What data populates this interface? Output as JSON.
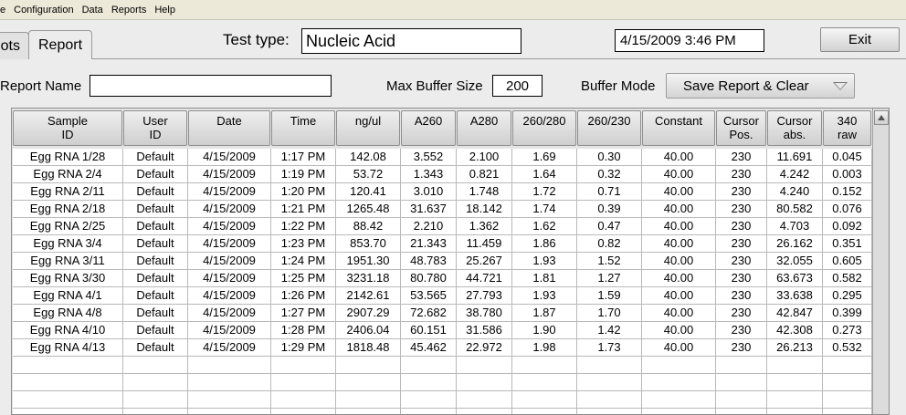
{
  "menubar": {
    "items": [
      "e",
      "Configuration",
      "Data",
      "Reports",
      "Help"
    ]
  },
  "tabs": [
    {
      "label": "ots",
      "selected": false
    },
    {
      "label": "Report",
      "selected": true
    }
  ],
  "header": {
    "test_type_label": "Test type:",
    "test_type_value": "Nucleic Acid",
    "datetime": "4/15/2009  3:46 PM",
    "exit_label": "Exit"
  },
  "controls": {
    "report_name_label": "Report Name",
    "report_name_value": "",
    "max_buffer_label": "Max Buffer Size",
    "max_buffer_value": "200",
    "buffer_mode_label": "Buffer Mode",
    "buffer_mode_value": "Save Report & Clear"
  },
  "table": {
    "columns": [
      "Sample\nID",
      "User\nID",
      "Date",
      "Time",
      "ng/ul",
      "A260",
      "A280",
      "260/280",
      "260/230",
      "Constant",
      "Cursor\nPos.",
      "Cursor\nabs.",
      "340\nraw"
    ],
    "rows": [
      [
        "Egg RNA 1/28",
        "Default",
        "4/15/2009",
        "1:17 PM",
        "142.08",
        "3.552",
        "2.100",
        "1.69",
        "0.30",
        "40.00",
        "230",
        "11.691",
        "0.045"
      ],
      [
        "Egg RNA 2/4",
        "Default",
        "4/15/2009",
        "1:19 PM",
        "53.72",
        "1.343",
        "0.821",
        "1.64",
        "0.32",
        "40.00",
        "230",
        "4.242",
        "0.003"
      ],
      [
        "Egg RNA 2/11",
        "Default",
        "4/15/2009",
        "1:20 PM",
        "120.41",
        "3.010",
        "1.748",
        "1.72",
        "0.71",
        "40.00",
        "230",
        "4.240",
        "0.152"
      ],
      [
        "Egg RNA 2/18",
        "Default",
        "4/15/2009",
        "1:21 PM",
        "1265.48",
        "31.637",
        "18.142",
        "1.74",
        "0.39",
        "40.00",
        "230",
        "80.582",
        "0.076"
      ],
      [
        "Egg RNA 2/25",
        "Default",
        "4/15/2009",
        "1:22 PM",
        "88.42",
        "2.210",
        "1.362",
        "1.62",
        "0.47",
        "40.00",
        "230",
        "4.703",
        "0.092"
      ],
      [
        "Egg RNA 3/4",
        "Default",
        "4/15/2009",
        "1:23 PM",
        "853.70",
        "21.343",
        "11.459",
        "1.86",
        "0.82",
        "40.00",
        "230",
        "26.162",
        "0.351"
      ],
      [
        "Egg RNA 3/11",
        "Default",
        "4/15/2009",
        "1:24 PM",
        "1951.30",
        "48.783",
        "25.267",
        "1.93",
        "1.52",
        "40.00",
        "230",
        "32.055",
        "0.605"
      ],
      [
        "Egg RNA 3/30",
        "Default",
        "4/15/2009",
        "1:25 PM",
        "3231.18",
        "80.780",
        "44.721",
        "1.81",
        "1.27",
        "40.00",
        "230",
        "63.673",
        "0.582"
      ],
      [
        "Egg RNA 4/1",
        "Default",
        "4/15/2009",
        "1:26 PM",
        "2142.61",
        "53.565",
        "27.793",
        "1.93",
        "1.59",
        "40.00",
        "230",
        "33.638",
        "0.295"
      ],
      [
        "Egg RNA 4/8",
        "Default",
        "4/15/2009",
        "1:27 PM",
        "2907.29",
        "72.682",
        "38.780",
        "1.87",
        "1.70",
        "40.00",
        "230",
        "42.847",
        "0.399"
      ],
      [
        "Egg RNA 4/10",
        "Default",
        "4/15/2009",
        "1:28 PM",
        "2406.04",
        "60.151",
        "31.586",
        "1.90",
        "1.42",
        "40.00",
        "230",
        "42.308",
        "0.273"
      ],
      [
        "Egg RNA 4/13",
        "Default",
        "4/15/2009",
        "1:29 PM",
        "1818.48",
        "45.462",
        "22.972",
        "1.98",
        "1.73",
        "40.00",
        "230",
        "26.213",
        "0.532"
      ]
    ]
  }
}
